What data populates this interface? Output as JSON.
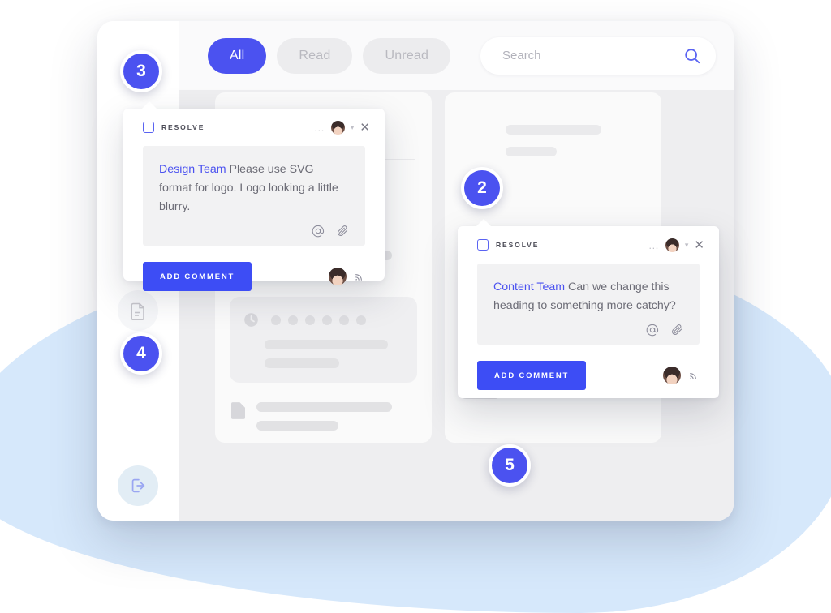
{
  "window": {
    "topbar": {
      "tabs": [
        {
          "label": "All",
          "active": true
        },
        {
          "label": "Read",
          "active": false
        },
        {
          "label": "Unread",
          "active": false
        }
      ],
      "search": {
        "placeholder": "Search",
        "value": "",
        "icon": "search-icon"
      }
    },
    "sidebar": {
      "items": [
        {
          "icon": "document-icon",
          "name": "documents"
        },
        {
          "icon": "logout-icon",
          "name": "logout"
        }
      ]
    }
  },
  "badges": [
    {
      "number": "3"
    },
    {
      "number": "4"
    },
    {
      "number": "2"
    },
    {
      "number": "5"
    }
  ],
  "popovers": [
    {
      "resolve_label": "RESOLVE",
      "menu_icon": "ellipsis-icon",
      "chevron_icon": "chevron-down-icon",
      "close_icon": "close-icon",
      "mention": "Design Team",
      "message": " Please use SVG format for logo. Logo looking a little blurry.",
      "tools": [
        "mention-icon",
        "attachment-icon"
      ],
      "button_label": "ADD COMMENT",
      "broadcast_icon": "broadcast-icon"
    },
    {
      "resolve_label": "RESOLVE",
      "menu_icon": "ellipsis-icon",
      "chevron_icon": "chevron-down-icon",
      "close_icon": "close-icon",
      "mention": "Content Team",
      "message": " Can we change this heading to something more catchy?",
      "tools": [
        "mention-icon",
        "attachment-icon"
      ],
      "button_label": "ADD COMMENT",
      "broadcast_icon": "broadcast-icon"
    }
  ],
  "cards": {
    "left": {
      "sections": [
        "cart-section",
        "clock-section",
        "document-section"
      ]
    },
    "right": {
      "sections": [
        "header-section",
        "list-section"
      ]
    }
  },
  "colors": {
    "accent": "#4b52f0",
    "button": "#3d4df5",
    "mention": "#4b52f0",
    "blob": "#d6e8fb",
    "content_bg": "#eeeef0",
    "skeleton": "#e2e2e4"
  }
}
